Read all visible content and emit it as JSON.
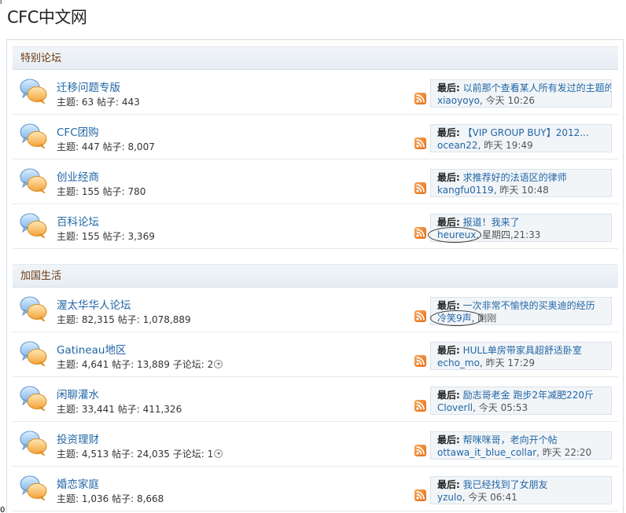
{
  "page": {
    "title": "CFC中文网",
    "corner_top": "I",
    "corner_bottom": "0"
  },
  "labels": {
    "topics": "主题:",
    "posts": "帖子:",
    "subforums": "子论坛:",
    "last": "最后:"
  },
  "sections": [
    {
      "title": "特别论坛",
      "forums": [
        {
          "name": "迁移问题专版",
          "topics": "63",
          "posts": "443",
          "subforums": "",
          "last_topic": "以前那个查看某人所有发过的主题的",
          "last_user": "xiaoyoyo",
          "last_time": "今天 10:26"
        },
        {
          "name": "CFC团购",
          "topics": "447",
          "posts": "8,007",
          "subforums": "",
          "last_topic": "【VIP GROUP BUY】2012...",
          "last_user": "ocean22",
          "last_time": "昨天 19:49"
        },
        {
          "name": "创业经商",
          "topics": "155",
          "posts": "780",
          "subforums": "",
          "last_topic": "求推荐好的法语区的律师",
          "last_user": "kangfu0119",
          "last_time": "昨天 10:48"
        },
        {
          "name": "百科论坛",
          "topics": "155",
          "posts": "3,369",
          "subforums": "",
          "last_topic": "报道！我来了",
          "last_user": "heureux",
          "last_time": "星期四,21:33"
        }
      ]
    },
    {
      "title": "加国生活",
      "forums": [
        {
          "name": "渥太华华人论坛",
          "topics": "82,315",
          "posts": "1,078,889",
          "subforums": "",
          "last_topic": "一次非常不愉快的买奥迪的经历",
          "last_user": "冷笑9声",
          "last_time": "刚刚"
        },
        {
          "name": "Gatineau地区",
          "topics": "4,641",
          "posts": "13,889",
          "subforums": "2",
          "last_topic": "HULL单房带家具超舒适卧室",
          "last_user": "echo_mo",
          "last_time": "昨天 17:29"
        },
        {
          "name": "闲聊灌水",
          "topics": "33,441",
          "posts": "411,326",
          "subforums": "",
          "last_topic": "励志哥老金 跑步2年减肥220斤",
          "last_user": "Cloverll",
          "last_time": "今天 05:53"
        },
        {
          "name": "投资理财",
          "topics": "4,513",
          "posts": "24,035",
          "subforums": "1",
          "last_topic": "帮咪咪哥，老向开个帖",
          "last_user": "ottawa_it_blue_collar",
          "last_time": "昨天 22:20"
        },
        {
          "name": "婚恋家庭",
          "topics": "1,036",
          "posts": "8,668",
          "subforums": "",
          "last_topic": "我已经找到了女朋友",
          "last_user": "yzulo",
          "last_time": "今天 06:41"
        }
      ]
    }
  ]
}
